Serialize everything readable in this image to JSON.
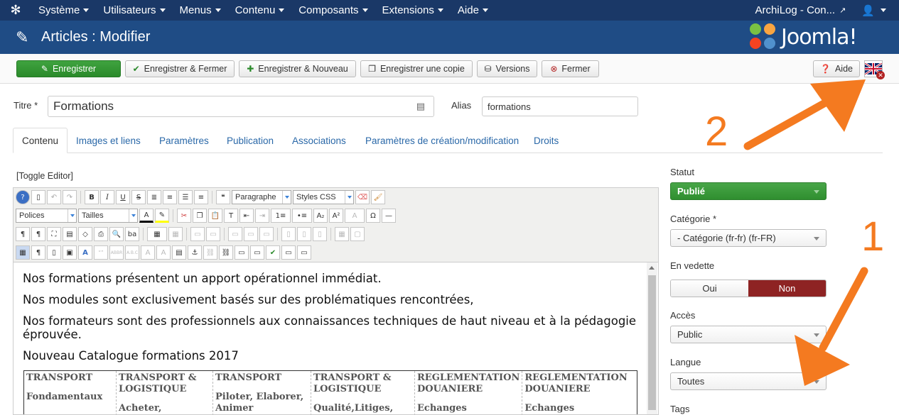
{
  "topnav": {
    "items": [
      "Système",
      "Utilisateurs",
      "Menus",
      "Contenu",
      "Composants",
      "Extensions",
      "Aide"
    ],
    "site": "ArchiLog - Con..."
  },
  "header": {
    "title": "Articles : Modifier",
    "brand": "Joomla!"
  },
  "toolbar": {
    "save": "Enregistrer",
    "save_close": "Enregistrer & Fermer",
    "save_new": "Enregistrer & Nouveau",
    "save_copy": "Enregistrer une copie",
    "versions": "Versions",
    "close": "Fermer",
    "help": "Aide"
  },
  "form": {
    "title_label": "Titre *",
    "title_value": "Formations",
    "alias_label": "Alias",
    "alias_value": "formations"
  },
  "tabs": [
    "Contenu",
    "Images et liens",
    "Paramètres",
    "Publication",
    "Associations",
    "Paramètres de création/modification",
    "Droits"
  ],
  "editor": {
    "toggle": "[Toggle Editor]",
    "format_select": "Paragraphe",
    "styles_select": "Styles CSS",
    "font_select": "Polices",
    "size_select": "Tailles",
    "paragraphs": [
      "Nos formations présentent un apport opérationnel immédiat.",
      "Nos modules sont exclusivement basés sur des problématiques rencontrées,",
      "Nos formateurs sont des professionnels aux connaissances techniques de haut niveau et à la pédagogie",
      "éprouvée.",
      "Nouveau Catalogue formations 2017"
    ],
    "table": [
      [
        "TRANSPORT",
        "TRANSPORT &",
        "TRANSPORT",
        "TRANSPORT &",
        "REGLEMENTATION",
        "REGLEMENTATION"
      ],
      [
        "",
        "LOGISTIQUE",
        "",
        "LOGISTIQUE",
        "DOUANIERE",
        "DOUANIERE"
      ],
      [
        "Fondamentaux",
        "",
        "Piloter, Elaborer,",
        "",
        "",
        ""
      ],
      [
        "",
        "Acheter,",
        "Animer",
        "Qualité,Litiges,",
        "Echanges",
        "Echanges"
      ]
    ]
  },
  "sidebar": {
    "status_label": "Statut",
    "status_value": "Publié",
    "category_label": "Catégorie *",
    "category_value": "- Catégorie (fr-fr) (fr-FR)",
    "featured_label": "En vedette",
    "featured_yes": "Oui",
    "featured_no": "Non",
    "access_label": "Accès",
    "access_value": "Public",
    "language_label": "Langue",
    "language_value": "Toutes",
    "tags_label": "Tags"
  },
  "annotations": {
    "one": "1",
    "two": "2"
  },
  "colors": {
    "nav": "#1a3867",
    "header": "#1f4c85",
    "green": "#2f8f2f",
    "red": "#8e2323",
    "arrow": "#f47a20"
  }
}
